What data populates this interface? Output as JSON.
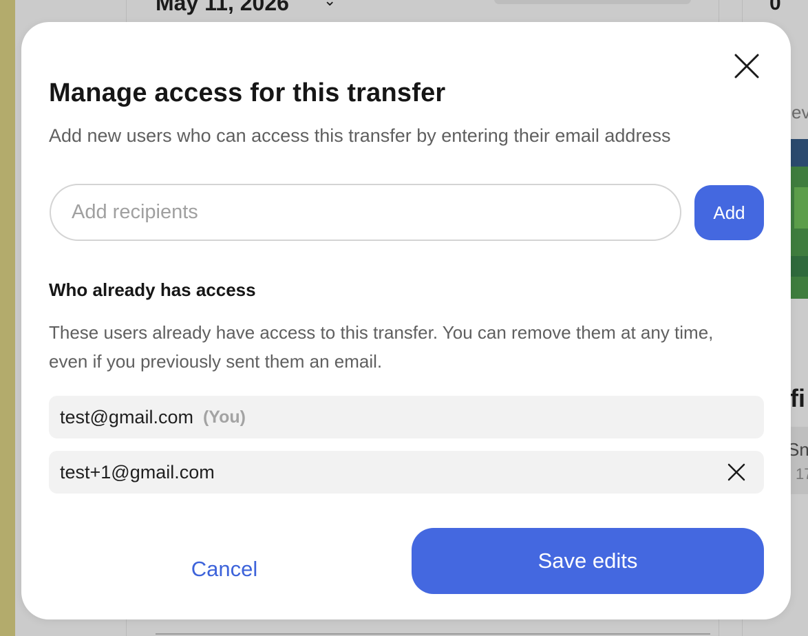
{
  "background": {
    "date_label": "May 11, 2026",
    "count_label": "0",
    "side_text_1": "ev",
    "side_text_2": "fi",
    "side_text_3": "Sn",
    "side_text_4": "17"
  },
  "modal": {
    "title": "Manage access for this transfer",
    "subtitle": "Add new users who can access this transfer by entering their email address",
    "recipient_input": {
      "placeholder": "Add recipients",
      "value": ""
    },
    "add_label": "Add",
    "access_section": {
      "heading": "Who already has access",
      "description": "These users already have access to this transfer. You can remove them at any time, even if you previously sent them an email.",
      "users": [
        {
          "email": "test@gmail.com",
          "tag": "(You)",
          "removable": false
        },
        {
          "email": "test+1@gmail.com",
          "tag": "",
          "removable": true
        }
      ]
    },
    "cancel_label": "Cancel",
    "save_label": "Save edits"
  },
  "colors": {
    "primary": "#4468e0",
    "link": "#3d63da",
    "row_background": "#f2f2f2"
  },
  "icons": {
    "close": "close-icon",
    "remove": "close-icon",
    "date_dropdown": "chevron-down-icon"
  }
}
